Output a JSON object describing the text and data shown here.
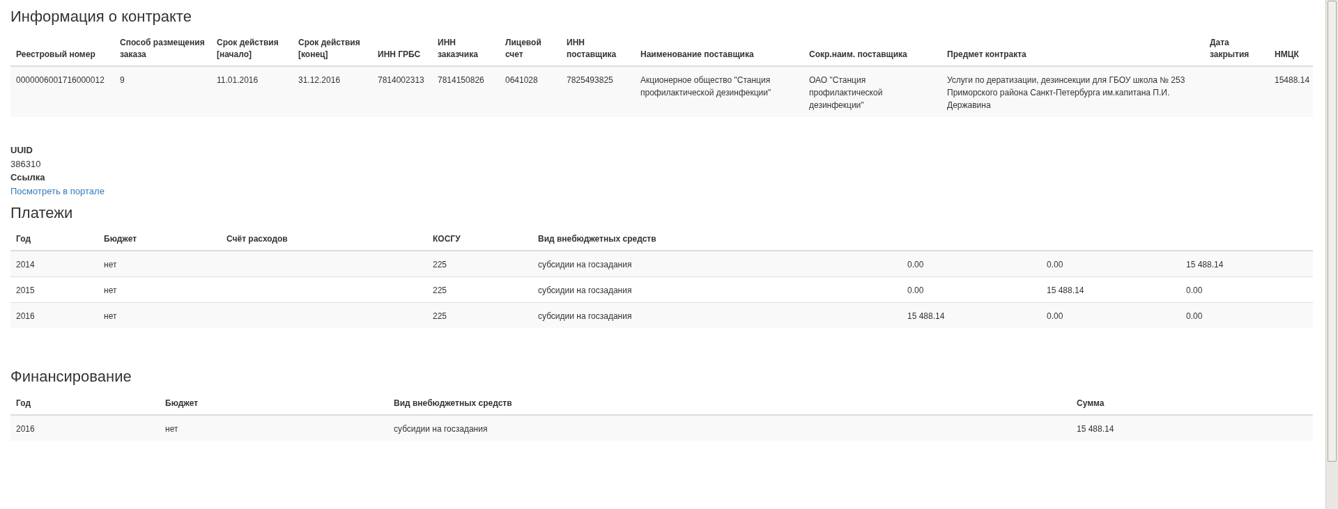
{
  "contract": {
    "title": "Информация о контракте",
    "columns": [
      "Реестровый номер",
      "Способ размещения заказа",
      "Срок действия [начало]",
      "Срок действия [конец]",
      "ИНН ГРБС",
      "ИНН заказчика",
      "Лицевой счет",
      "ИНН поставщика",
      "Наименование поставщика",
      "Сокр.наим. поставщика",
      "Предмет контракта",
      "Дата закрытия",
      "НМЦК"
    ],
    "rows": [
      {
        "cells": [
          "0000006001716000012",
          "9",
          "11.01.2016",
          "31.12.2016",
          "7814002313",
          "7814150826",
          "0641028",
          "7825493825",
          "Акционерное общество \"Станция профилактической дезинфекции\"",
          "ОАО \"Станция профилактической дезинфекции\"",
          "Услуги по дератизации, дезинсекции для ГБОУ школа № 253 Приморского района Санкт-Петербурга им.капитана П.И. Державина",
          "",
          "15488.14"
        ]
      }
    ]
  },
  "details": [
    {
      "label": "UUID",
      "value": "386310",
      "kind": "text"
    },
    {
      "label": "Ссылка",
      "value": "Посмотреть в портале",
      "kind": "link"
    }
  ],
  "payments": {
    "title": "Платежи",
    "columns": [
      "Год",
      "Бюджет",
      "Счёт расходов",
      "КОСГУ",
      "Вид внебюджетных средств",
      "",
      "",
      ""
    ],
    "rows": [
      {
        "cells": [
          "2014",
          "нет",
          "",
          "225",
          "субсидии на госзадания",
          "0.00",
          "0.00",
          "15 488.14"
        ]
      },
      {
        "cells": [
          "2015",
          "нет",
          "",
          "225",
          "субсидии на госзадания",
          "0.00",
          "15 488.14",
          "0.00"
        ]
      },
      {
        "cells": [
          "2016",
          "нет",
          "",
          "225",
          "субсидии на госзадания",
          "15 488.14",
          "0.00",
          "0.00"
        ]
      }
    ]
  },
  "financing": {
    "title": "Финансирование",
    "columns": [
      "Год",
      "Бюджет",
      "Вид внебюджетных средств",
      "Сумма"
    ],
    "rows": [
      {
        "cells": [
          "2016",
          "нет",
          "субсидии на госзадания",
          "15 488.14"
        ]
      }
    ]
  }
}
